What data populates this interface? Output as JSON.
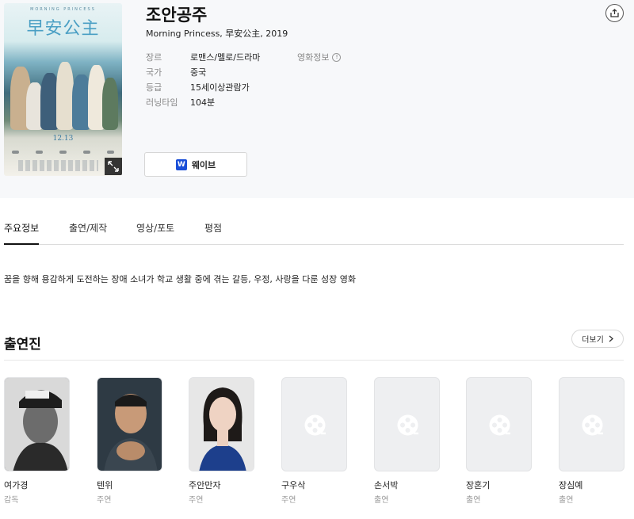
{
  "movie": {
    "title": "조안공주",
    "subtitle": "Morning Princess, 早安公主, 2019"
  },
  "poster": {
    "english_title": "MORNING PRINCESS",
    "chinese_title": "早安公主",
    "date": "12.13"
  },
  "info": [
    {
      "key": "장르",
      "value": "로맨스/멜로/드라마"
    },
    {
      "key": "국가",
      "value": "중국"
    },
    {
      "key": "등급",
      "value": "15세이상관람가"
    },
    {
      "key": "러닝타임",
      "value": "104분"
    }
  ],
  "movie_info_label": "영화정보",
  "movie_info_glyph": "!",
  "streaming": {
    "label": "웨이브",
    "logo_letter": "W",
    "logo_color": "#1a4fd8"
  },
  "tabs": [
    "주요정보",
    "출연/제작",
    "영상/포토",
    "평점"
  ],
  "synopsis": "꿈을 향해 용감하게 도전하는 장애 소녀가 학교 생활 중에 겪는 갈등, 우정, 사랑을 다룬 성장 영화",
  "cast_section": {
    "title": "출연진",
    "more_label": "더보기"
  },
  "cast": [
    {
      "name": "여가경",
      "role": "감독",
      "photo": "bw-cap"
    },
    {
      "name": "텐위",
      "role": "주연",
      "photo": "man"
    },
    {
      "name": "주안만자",
      "role": "주연",
      "photo": "woman"
    },
    {
      "name": "구우삭",
      "role": "주연",
      "photo": "placeholder"
    },
    {
      "name": "손서박",
      "role": "출연",
      "photo": "placeholder"
    },
    {
      "name": "장혼기",
      "role": "출연",
      "photo": "placeholder"
    },
    {
      "name": "장심예",
      "role": "출연",
      "photo": "placeholder"
    }
  ]
}
